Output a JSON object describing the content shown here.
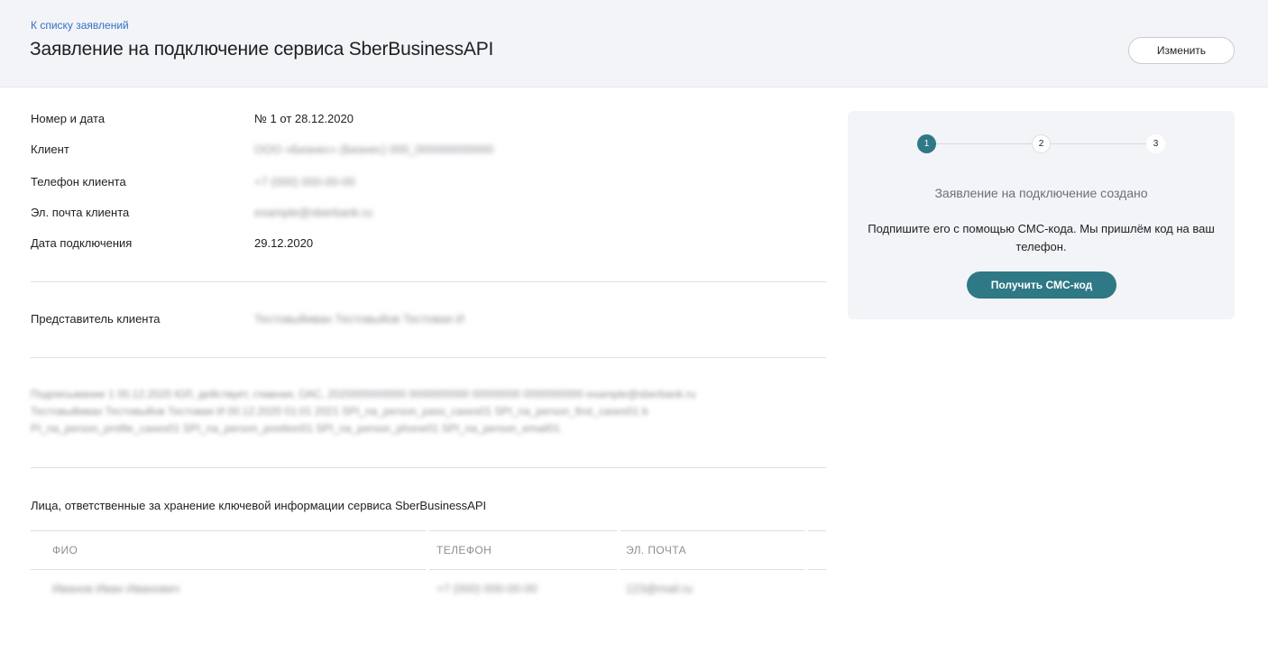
{
  "header": {
    "back_link": "К списку заявлений",
    "title": "Заявление на подключение сервиса SberBusinessAPI",
    "edit_label": "Изменить"
  },
  "details": {
    "number_label": "Номер и дата",
    "number_value": "№ 1 от 28.12.2020",
    "client_label": "Клиент",
    "client_value": "ООО «Бизнес» (Бизнес) 000_000000000000",
    "phone_label": "Телефон клиента",
    "phone_value": "+7 (000) 000-00-00",
    "email_label": "Эл. почта клиента",
    "email_value": "example@sberbank.ru",
    "date_label": "Дата подключения",
    "date_value": "29.12.2020",
    "rep_label": "Представитель клиента",
    "rep_value": "Тестовыйиван Тестовыйов Тестовая И"
  },
  "consent": {
    "line1": "Подписывание 1 00.12.2020 ЮЛ, действует, главная, ОАС, 2020000000000 0000000000 00000000 0000000000 example@sberbank.ru",
    "line2": "Тестовыйиван Тестовыйов Тестовая И 00.12.2020 01:01 2021 SPI_na_person_pass_cases01 SPI_na_person_first_cases01 b",
    "line3": "PI_na_person_profile_cases01 SPI_na_person_position01 SPI_na_person_phone01 SPI_na_person_email01"
  },
  "responsible": {
    "title": "Лица, ответственные за хранение ключевой информации сервиса SberBusinessAPI",
    "columns": [
      "ФИО",
      "ТЕЛЕФОН",
      "ЭЛ. ПОЧТА"
    ],
    "rows": [
      [
        "Иванов Иван Иванович",
        "+7 (000) 000-00-00",
        "123@mail.ru"
      ]
    ]
  },
  "side_card": {
    "steps": [
      "1",
      "2",
      "3"
    ],
    "status": "Заявление на подключение создано",
    "instruction": "Подпишите его с помощью СМС-кода. Мы пришлём код на ваш телефон.",
    "button_label": "Получить СМС-код"
  },
  "colors": {
    "accent": "#2f7885",
    "link": "#3670c7",
    "header_bg": "#f2f4f7",
    "muted_text": "#8c8f96"
  }
}
